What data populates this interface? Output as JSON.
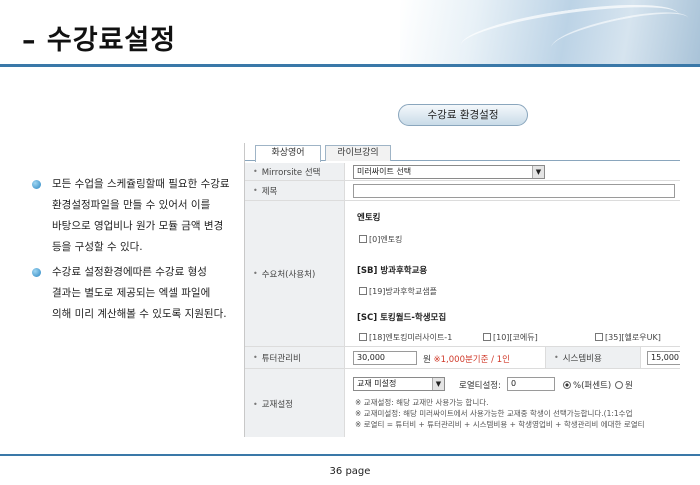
{
  "title": "– 수강료설정",
  "bullets": [
    "모든 수업을 스케쥴링할때 필요한 수강료 환경설정파일을 만들 수 있어서 이를 바탕으로 영업비나 원가 모듈 금액 변경 등을 구성할 수 있다.",
    "수강료 설정환경에따른 수강료 형성 결과는 별도로 제공되는 엑셀 파일에 의해 미리 계산해볼 수 있도록 지원된다."
  ],
  "section_label": "수강료 환경설정",
  "tabs": [
    "화상영어",
    "라이브강의"
  ],
  "form": {
    "mirrorsite_label": "Mirrorsite 선택",
    "mirrorsite_value": "미러싸이트 선택",
    "title_label": "제목",
    "title_value": "",
    "source_label": "수요처(사용처)",
    "groups": [
      {
        "title": "엔토킹",
        "items": [
          "[0]엔토킹"
        ]
      },
      {
        "title": "[SB] 방과후학교용",
        "items": [
          "[19]방과후학교샘플"
        ]
      },
      {
        "title": "[SC] 토킹월드-학생모집",
        "items": [
          "[18]엔토킹미러사이트-1",
          "[10][코에듀]",
          "[35][헬로우UK]"
        ]
      }
    ],
    "tutor_label": "튜터관리비",
    "tutor_value": "30,000",
    "tutor_unit": "원",
    "tutor_note": "※1,000분기준 / 1인",
    "system_label": "시스템비용",
    "system_value": "15,000",
    "textbook_label": "교재설정",
    "textbook_select": "교재 미설정",
    "royalty_label": "로열티설정:",
    "royalty_value": "0",
    "radio_percent": "%(퍼센트)",
    "radio_won": "원",
    "notes": [
      "※ 교재설정: 해당 교재만 사용가능 합니다.",
      "※ 교재미설정: 해당 미러싸이트에서 사용가능한 교재중 학생이 선택가능합니다.(1:1수업",
      "※ 로열티 = 튜터비 + 튜터관리비 + 시스템비용 + 학생영업비 + 학생관리비 에대한 로열티"
    ]
  },
  "footer": "36 page"
}
